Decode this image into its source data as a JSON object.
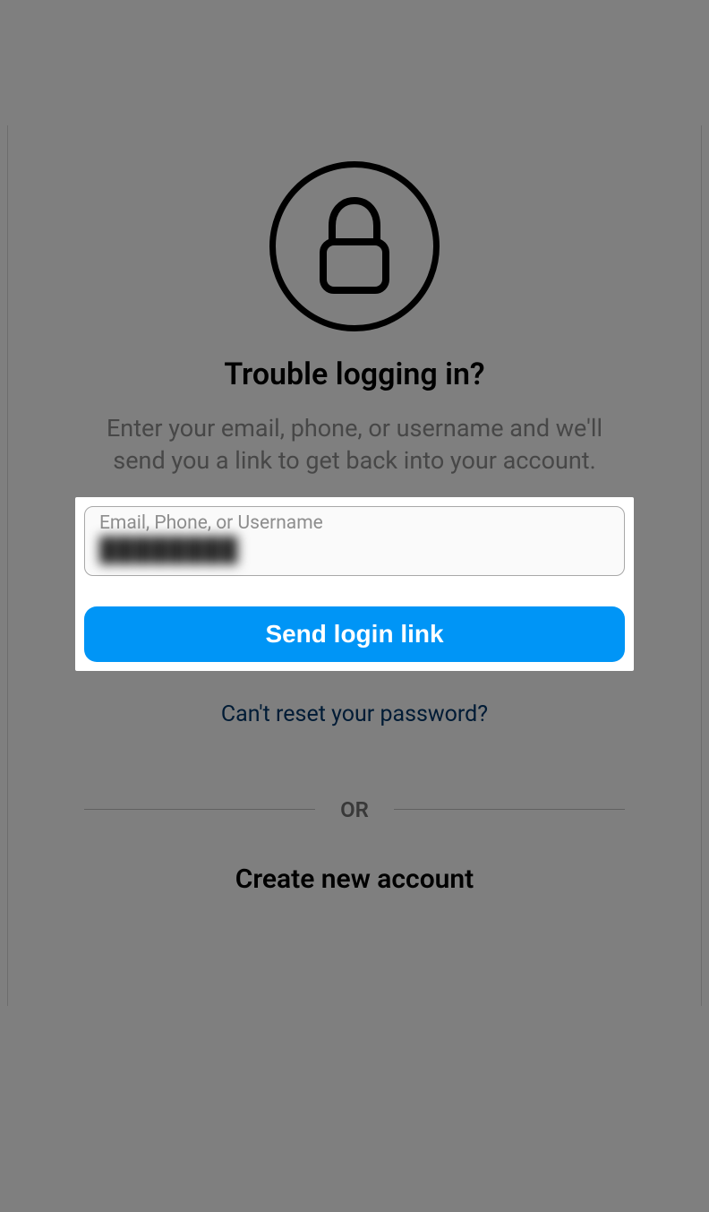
{
  "heading": "Trouble logging in?",
  "subtitle": "Enter your email, phone, or username and we'll send you a link to get back into your account.",
  "input": {
    "label": "Email, Phone, or Username",
    "value": "████████"
  },
  "send_button": "Send login link",
  "cant_reset": "Can't reset your password?",
  "or": "OR",
  "create_account": "Create new account"
}
